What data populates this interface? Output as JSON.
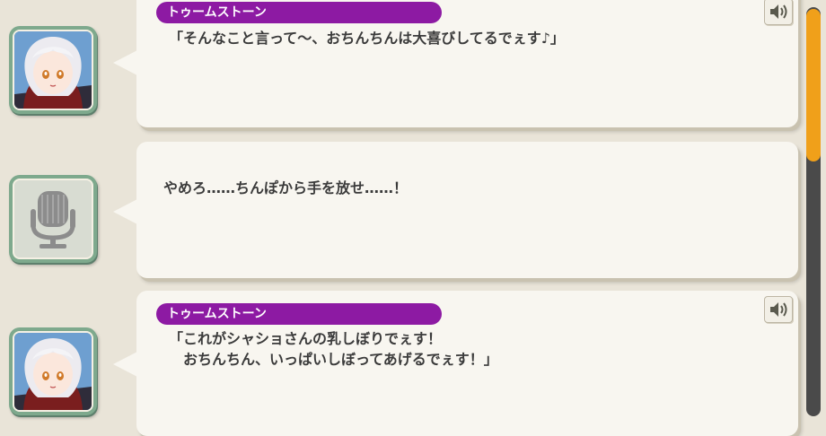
{
  "messages": [
    {
      "speaker": "トゥームストーン",
      "text": "「そんなこと言って～、おちんちんは大喜びしてるでぇす♪」",
      "has_voice": true,
      "avatar": "character-portrait"
    },
    {
      "speaker": "",
      "text": "やめろ……ちんぽから手を放せ……！",
      "has_voice": false,
      "avatar": "microphone-icon"
    },
    {
      "speaker": "トゥームストーン",
      "text": "「これがシャショさんの乳しぼりでぇす！\n　おちんちん、いっぱいしぼってあげるでぇす！」",
      "has_voice": true,
      "avatar": "character-portrait"
    }
  ],
  "colors": {
    "background": "#e9e4d8",
    "bubble": "#f8f6f0",
    "name_tag": "#8d1aa3",
    "avatar_frame": "#7ea98d",
    "scroll_thumb": "#f0a01a",
    "scroll_track": "#4a4a4a"
  },
  "scrollbar": {
    "position_fraction": 0.0
  }
}
